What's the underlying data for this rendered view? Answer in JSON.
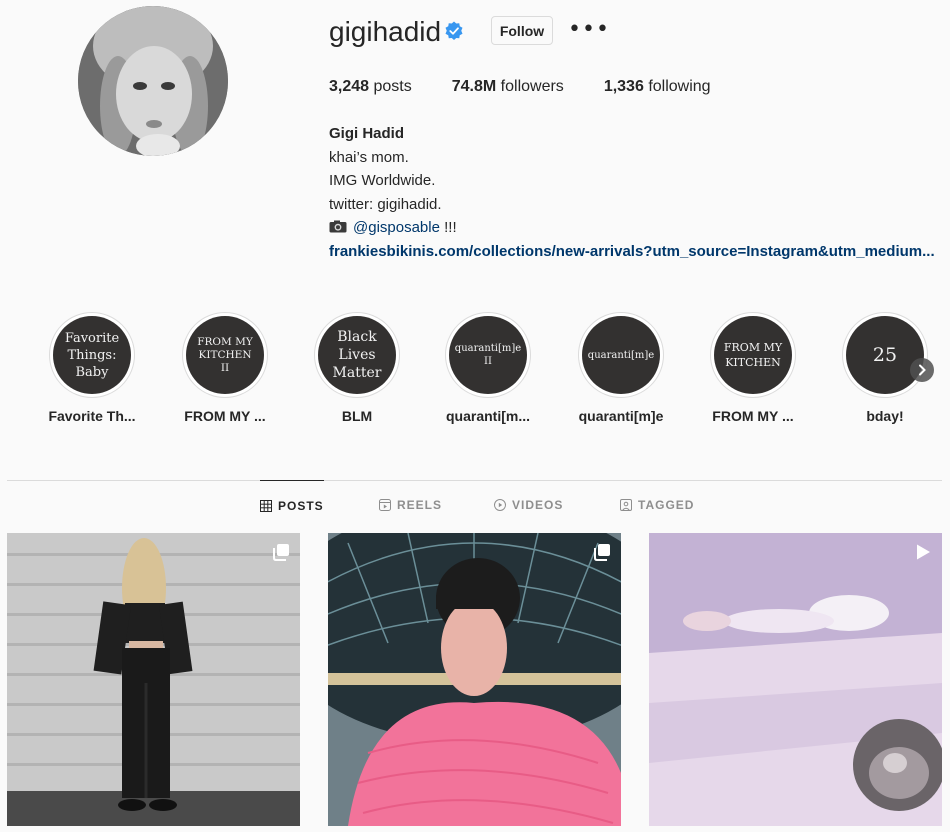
{
  "profile": {
    "username": "gigihadid",
    "follow_label": "Follow",
    "more_label": "•••",
    "stats": [
      {
        "value": "3,248",
        "label": "posts"
      },
      {
        "value": "74.8M",
        "label": "followers"
      },
      {
        "value": "1,336",
        "label": "following"
      }
    ],
    "full_name": "Gigi Hadid",
    "bio_lines": [
      "khai’s mom.",
      "IMG Worldwide.",
      "twitter: gigihadid."
    ],
    "camera_handle": "@gisposable",
    "camera_suffix": " !!!",
    "link": "frankiesbikinis.com/collections/new-arrivals?utm_source=Instagram&utm_medium..."
  },
  "highlights": [
    {
      "cover_lines": [
        "Favorite",
        "Things:",
        "Baby"
      ],
      "label": "Favorite Th..."
    },
    {
      "cover_lines": [
        "FROM MY",
        "KITCHEN",
        "II"
      ],
      "label": "FROM MY ..."
    },
    {
      "cover_lines": [
        "Black",
        "Lives",
        "Matter"
      ],
      "label": "BLM"
    },
    {
      "cover_lines": [
        "quaranti[m]e",
        "II"
      ],
      "label": "quaranti[m..."
    },
    {
      "cover_lines": [
        "quaranti[m]e"
      ],
      "label": "quaranti[m]e"
    },
    {
      "cover_lines": [
        "FROM MY",
        "KITCHEN"
      ],
      "label": "FROM MY ..."
    },
    {
      "cover_lines": [
        "25"
      ],
      "label": "bday!"
    }
  ],
  "tabs": [
    {
      "label": "POSTS",
      "icon": "grid-icon",
      "active": true
    },
    {
      "label": "REELS",
      "icon": "reels-icon",
      "active": false
    },
    {
      "label": "VIDEOS",
      "icon": "video-icon",
      "active": false
    },
    {
      "label": "TAGGED",
      "icon": "tagged-icon",
      "active": false
    }
  ],
  "posts": [
    {
      "badge": "carousel-icon"
    },
    {
      "badge": "carousel-icon"
    },
    {
      "badge": "video-play-icon"
    }
  ],
  "colors": {
    "link": "#00376b",
    "verified": "#3897f0",
    "text": "#262626",
    "muted": "#8e8e8e",
    "highlight_bg": "#333130"
  }
}
